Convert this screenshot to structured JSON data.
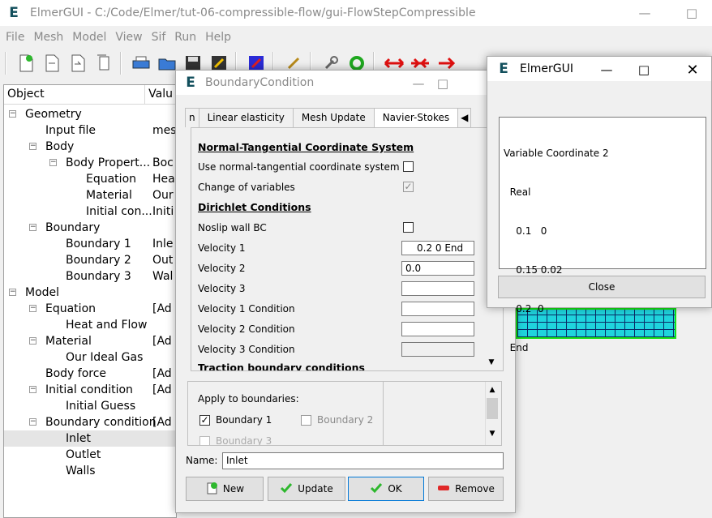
{
  "main": {
    "title": "ElmerGUI - C:/Code/Elmer/tut-06-compressible-flow/gui-FlowStepCompressible",
    "app_letter": "E",
    "menus": [
      "File",
      "Mesh",
      "Model",
      "View",
      "Sif",
      "Run",
      "Help"
    ],
    "tree_headers": [
      "Object",
      "Valu"
    ],
    "tree": [
      {
        "label": "Geometry",
        "value": "",
        "level": 0,
        "expander": "minus"
      },
      {
        "label": "Input file",
        "value": "mes",
        "level": 1,
        "expander": ""
      },
      {
        "label": "Body",
        "value": "",
        "level": 1,
        "expander": "minus"
      },
      {
        "label": "Body Propert...",
        "value": "Boc",
        "level": 2,
        "expander": "minus"
      },
      {
        "label": "Equation",
        "value": "Hea",
        "level": 3,
        "expander": ""
      },
      {
        "label": "Material",
        "value": "Our",
        "level": 3,
        "expander": ""
      },
      {
        "label": "Initial con...",
        "value": "Initi",
        "level": 3,
        "expander": ""
      },
      {
        "label": "Boundary",
        "value": "",
        "level": 1,
        "expander": "minus"
      },
      {
        "label": "Boundary 1",
        "value": "Inle",
        "level": 2,
        "expander": ""
      },
      {
        "label": "Boundary 2",
        "value": "Out",
        "level": 2,
        "expander": ""
      },
      {
        "label": "Boundary 3",
        "value": "Wal",
        "level": 2,
        "expander": ""
      },
      {
        "label": "Model",
        "value": "",
        "level": 0,
        "expander": "minus"
      },
      {
        "label": "Equation",
        "value": "[Ad",
        "level": 1,
        "expander": "minus"
      },
      {
        "label": "Heat and Flow",
        "value": "",
        "level": 2,
        "expander": ""
      },
      {
        "label": "Material",
        "value": "[Ad",
        "level": 1,
        "expander": "minus"
      },
      {
        "label": "Our Ideal Gas",
        "value": "",
        "level": 2,
        "expander": ""
      },
      {
        "label": "Body force",
        "value": "[Ad",
        "level": 1,
        "expander": ""
      },
      {
        "label": "Initial condition",
        "value": "[Ad",
        "level": 1,
        "expander": "minus"
      },
      {
        "label": "Initial Guess",
        "value": "",
        "level": 2,
        "expander": ""
      },
      {
        "label": "Boundary condition",
        "value": "[Ad",
        "level": 1,
        "expander": "minus"
      },
      {
        "label": "Inlet",
        "value": "",
        "level": 2,
        "expander": "",
        "selected": true
      },
      {
        "label": "Outlet",
        "value": "",
        "level": 2,
        "expander": ""
      },
      {
        "label": "Walls",
        "value": "",
        "level": 2,
        "expander": ""
      }
    ]
  },
  "bc_dialog": {
    "title": "BoundaryCondition",
    "tabs": [
      "n",
      "Linear elasticity",
      "Mesh Update",
      "Navier-Stokes"
    ],
    "active_tab": "Navier-Stokes",
    "section1": "Normal-Tangential Coordinate System",
    "use_nt_label": "Use normal-tangential coordinate system",
    "change_vars_label": "Change of variables",
    "change_vars_checked": true,
    "section2": "Dirichlet Conditions",
    "noslip_label": "Noslip wall BC",
    "fields": [
      {
        "label": "Velocity 1",
        "value": "0.2  0   End"
      },
      {
        "label": "Velocity 2",
        "value": "0.0"
      },
      {
        "label": "Velocity 3",
        "value": ""
      },
      {
        "label": "Velocity 1 Condition",
        "value": ""
      },
      {
        "label": "Velocity 2 Condition",
        "value": ""
      },
      {
        "label": "Velocity 3 Condition",
        "value": ""
      }
    ],
    "section3": "Traction boundary conditions",
    "apply_label": "Apply to boundaries:",
    "boundaries": [
      {
        "label": "Boundary 1",
        "checked": true
      },
      {
        "label": "Boundary 2",
        "checked": false
      },
      {
        "label": "Boundary 3",
        "checked": false
      }
    ],
    "name_label": "Name:",
    "name_value": "Inlet",
    "buttons": {
      "new": "New",
      "update": "Update",
      "ok": "OK",
      "remove": "Remove"
    }
  },
  "popup": {
    "title": "ElmerGUI",
    "text_lines": [
      "Variable Coordinate 2",
      "  Real",
      "    0.1   0",
      "    0.15 0.02",
      "    0.2  0",
      "  End"
    ],
    "close_label": "Close"
  },
  "colors": {
    "accent": "#0078d7",
    "mesh_fill": "#1fd4dd",
    "mesh_border": "#16e016",
    "elmer_e": "#124f5c"
  }
}
